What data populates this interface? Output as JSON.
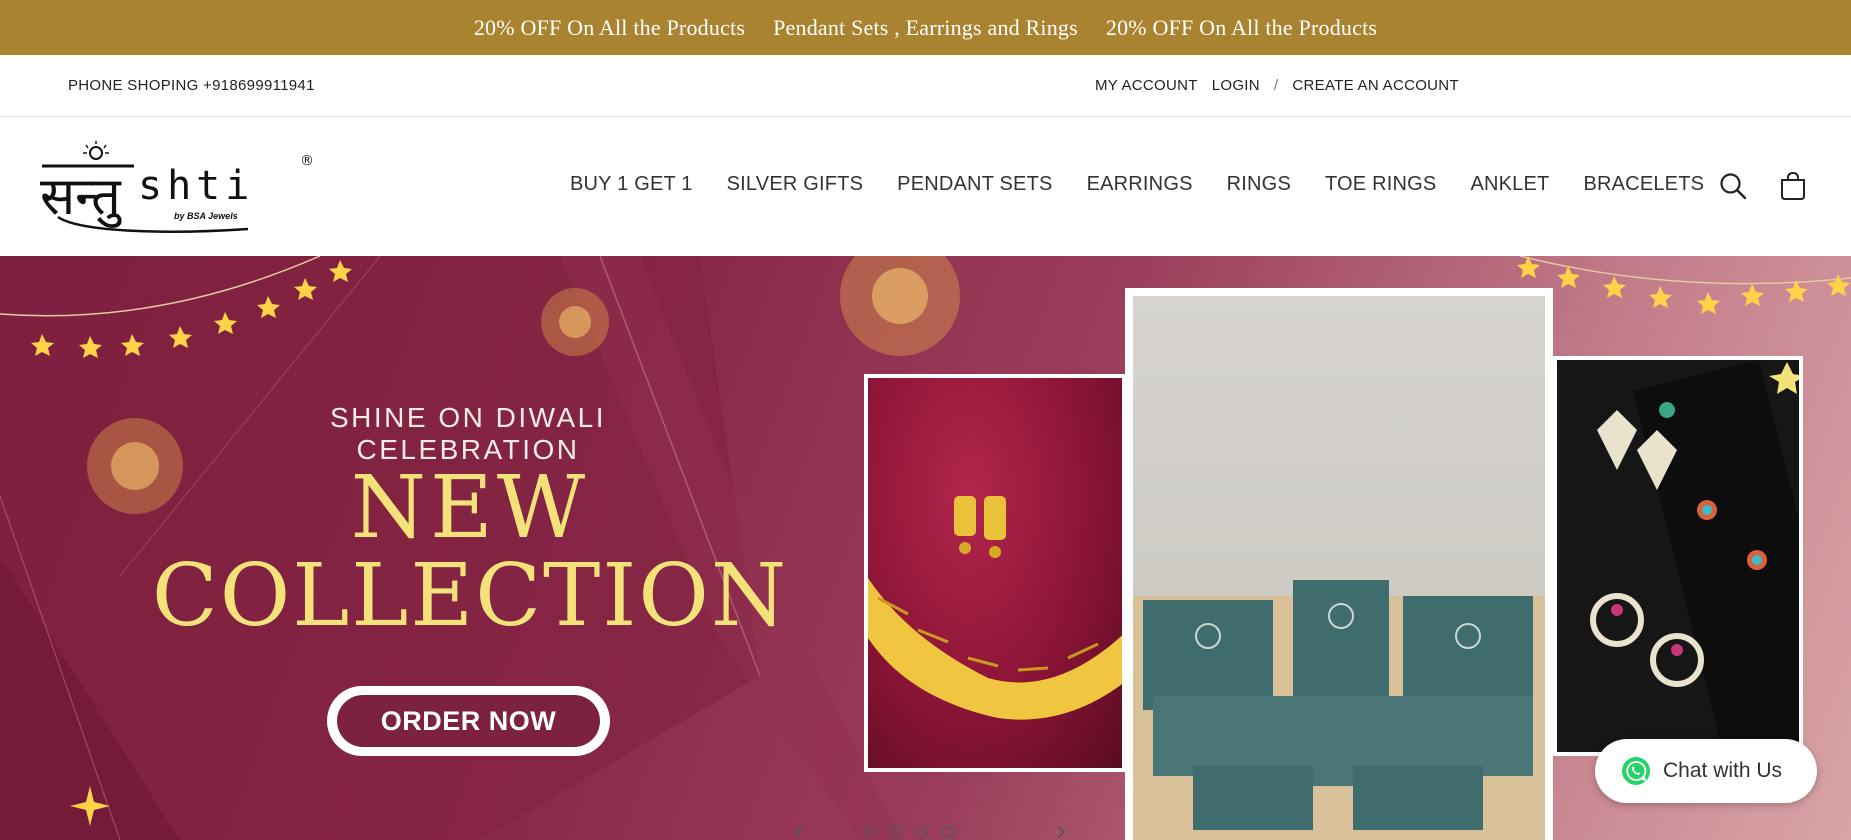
{
  "announcement": {
    "items": [
      "20% OFF On All the Products",
      "Pendant Sets , Earrings and Rings",
      "20% OFF On All the Products"
    ]
  },
  "utility": {
    "phone": "PHONE SHOPING +918699911941",
    "my_account": "MY ACCOUNT",
    "login": "LOGIN",
    "separator": "/",
    "create_account": "CREATE AN ACCOUNT"
  },
  "logo": {
    "wordmark_devanagari": "सन्तु",
    "wordmark_latin": "shti",
    "tagline": "by BSA Jewels",
    "registered": "®"
  },
  "nav": {
    "items": [
      "BUY 1 GET 1",
      "SILVER GIFTS",
      "PENDANT SETS",
      "EARRINGS",
      "RINGS",
      "TOE RINGS",
      "ANKLET",
      "BRACELETS"
    ]
  },
  "header_icons": {
    "search": "search-icon",
    "cart": "cart-icon"
  },
  "hero": {
    "tagline": "SHINE ON DIWALI CELEBRATION",
    "headline_line1": "NEW",
    "headline_line2": "COLLECTION",
    "cta": "ORDER NOW"
  },
  "chat": {
    "label": "Chat with Us",
    "icon": "whatsapp-icon"
  },
  "colors": {
    "announcement_bg": "#a98330",
    "hero_bg": "#7c1f3e",
    "headline_gold": "#f3e27a",
    "cta_bg": "#7d2140",
    "whatsapp_green": "#25d366"
  }
}
